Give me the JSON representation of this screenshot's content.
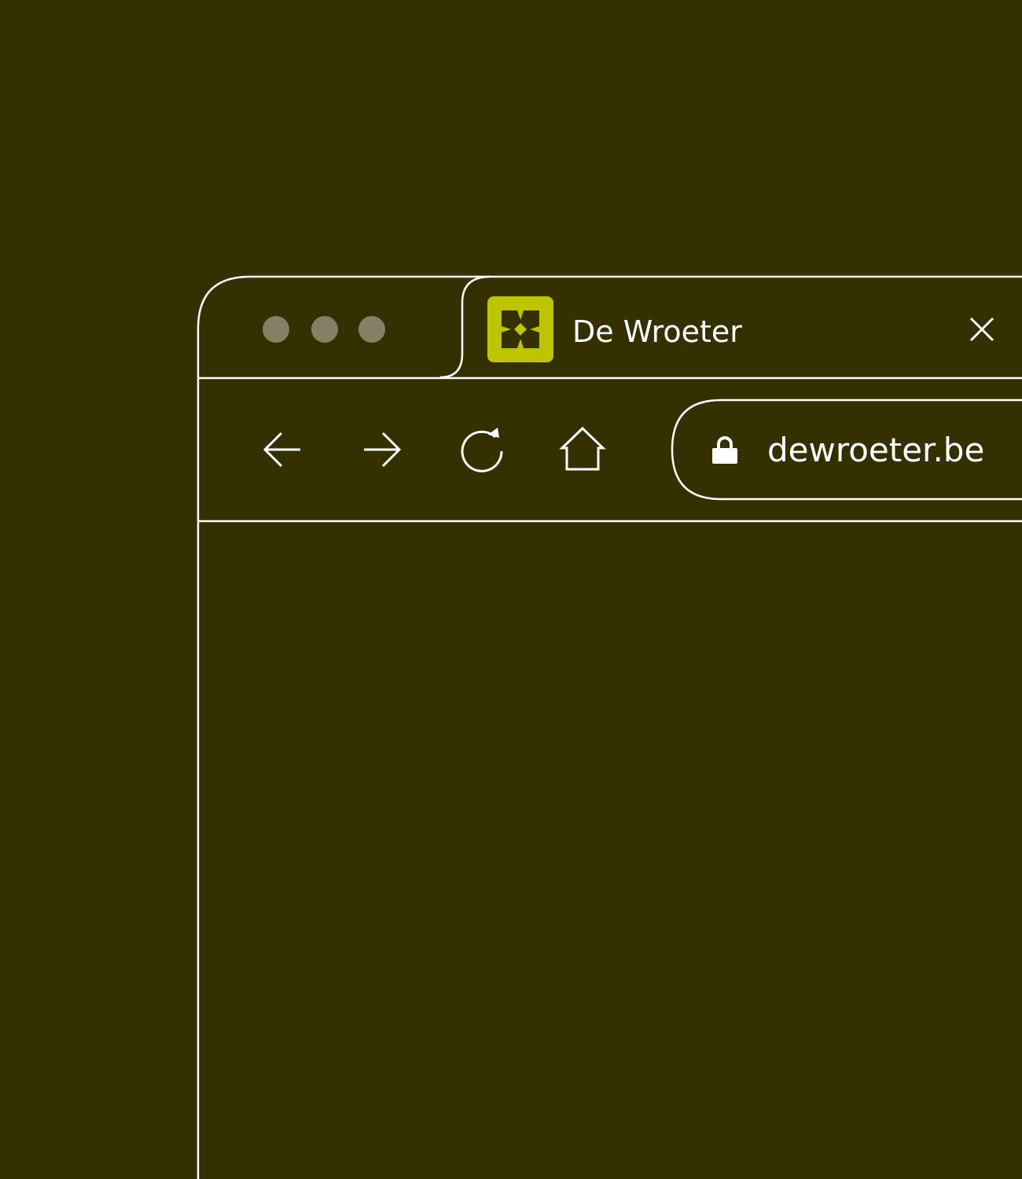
{
  "colors": {
    "background": "#343002",
    "line": "#ffffff",
    "dots": "#857f66",
    "accent": "#bdc400",
    "logo_mark": "#343002",
    "text": "#ffffff"
  },
  "window_controls": {
    "icons": [
      "window-dot-icon",
      "window-dot-icon",
      "window-dot-icon"
    ]
  },
  "tab": {
    "favicon_icon": "de-wroeter-logo-icon",
    "title": "De Wroeter",
    "close_icon": "close-icon"
  },
  "toolbar": {
    "back_icon": "arrow-left-icon",
    "forward_icon": "arrow-right-icon",
    "reload_icon": "reload-icon",
    "home_icon": "home-icon"
  },
  "address_bar": {
    "lock_icon": "lock-icon",
    "url": "dewroeter.be"
  }
}
